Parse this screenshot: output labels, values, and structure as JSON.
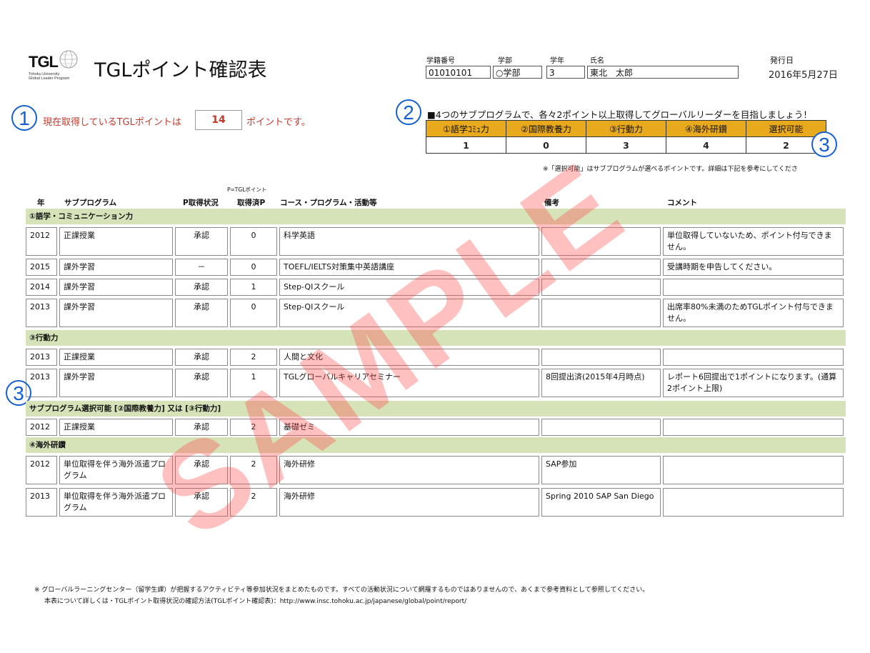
{
  "header": {
    "logo_text": "TGL",
    "logo_sub1": "Tohoku University",
    "logo_sub2": "Global Leader Program",
    "title": "TGLポイント確認表",
    "student_no_label": "学籍番号",
    "student_no": "01010101",
    "faculty_label": "学部",
    "faculty": "○学部",
    "year_label": "学年",
    "year": "3",
    "name_label": "氏名",
    "name": "東北　太郎",
    "issue_label": "発行日",
    "issue_date": "2016年5月27日"
  },
  "markers": {
    "m1": "1",
    "m2": "2",
    "m3a": "3",
    "m3b": "3"
  },
  "points": {
    "prefix": "現在取得しているTGLポイントは",
    "value": "14",
    "suffix": "ポイントです。"
  },
  "subprograms": {
    "heading": "■4つのサブプログラムで、各々2ポイント以上取得してグローバルリーダーを目指しましょう！",
    "headers": [
      "①語学ｺﾐｭ力",
      "②国際教養力",
      "③行動力",
      "④海外研鑽",
      "選択可能"
    ],
    "values": [
      "1",
      "0",
      "3",
      "4",
      "2"
    ],
    "note": "※「選択可能」はサブプログラムが選べるポイントです。詳細は下記を参考にしてくださ"
  },
  "columns": {
    "year": "年",
    "subprogram": "サブプログラム",
    "status": "P取得状況",
    "p_note": "P=TGLポイント",
    "points": "取得済P",
    "course": "コース・プログラム・活動等",
    "remarks": "備考",
    "comment": "コメント"
  },
  "sections": [
    {
      "title": "①語学・コミュニケーション力",
      "rows": [
        {
          "year": "2012",
          "sub": "正課授業",
          "status": "承認",
          "p": "0",
          "course": "科学英語",
          "remarks": "",
          "comment": "単位取得していないため、ポイント付与できません。"
        },
        {
          "year": "2015",
          "sub": "課外学習",
          "status": "－",
          "p": "0",
          "course": "TOEFL/IELTS対策集中英語講座",
          "remarks": "",
          "comment": "受講時期を申告してください。"
        },
        {
          "year": "2014",
          "sub": "課外学習",
          "status": "承認",
          "p": "1",
          "course": "Step-QIスクール",
          "remarks": "",
          "comment": ""
        },
        {
          "year": "2013",
          "sub": "課外学習",
          "status": "承認",
          "p": "0",
          "course": "Step-QIスクール",
          "remarks": "",
          "comment": "出席率80%未満のためTGLポイント付与できません。"
        }
      ]
    },
    {
      "title": "③行動力",
      "rows": [
        {
          "year": "2013",
          "sub": "正課授業",
          "status": "承認",
          "p": "2",
          "course": "人間と文化",
          "remarks": "",
          "comment": ""
        },
        {
          "year": "2013",
          "sub": "課外学習",
          "status": "承認",
          "p": "1",
          "course": "TGLグローバルキャリアセミナー",
          "remarks": "8回提出済(2015年4月時点)",
          "comment": "レポート6回提出で1ポイントになります。(通算2ポイント上限)"
        }
      ]
    },
    {
      "title": "サブプログラム選択可能 [②国際教養力] 又は [③行動力]",
      "rows": [
        {
          "year": "2012",
          "sub": "正課授業",
          "status": "承認",
          "p": "2",
          "course": "基礎ゼミ",
          "remarks": "",
          "comment": ""
        }
      ]
    },
    {
      "title": "④海外研鑽",
      "rows": [
        {
          "year": "2012",
          "sub": "単位取得を伴う海外派遣プログラム",
          "status": "承認",
          "p": "2",
          "course": "海外研修",
          "remarks": "SAP参加",
          "comment": ""
        },
        {
          "year": "2013",
          "sub": "単位取得を伴う海外派遣プログラム",
          "status": "承認",
          "p": "2",
          "course": "海外研修",
          "remarks": "Spring 2010 SAP San Diego",
          "comment": ""
        }
      ]
    }
  ],
  "footer": {
    "line1": "※ グローバルラーニングセンター（留学生課）が把握するアクティビティ等参加状況をまとめたものです。すべての活動状況について網羅するものではありませんので、あくまで参考資料として参照してください。",
    "line2": "本表について詳しくは・TGLポイント取得状況の確認方法(TGLポイント確認表)：http://www.insc.tohoku.ac.jp/japanese/global/point/report/"
  },
  "watermark": "SAMPLE",
  "colors": {
    "accent_orange": "#e8a91d",
    "section_green": "#d6e3b8",
    "marker_blue": "#1560d0",
    "points_red": "#c0392b"
  }
}
